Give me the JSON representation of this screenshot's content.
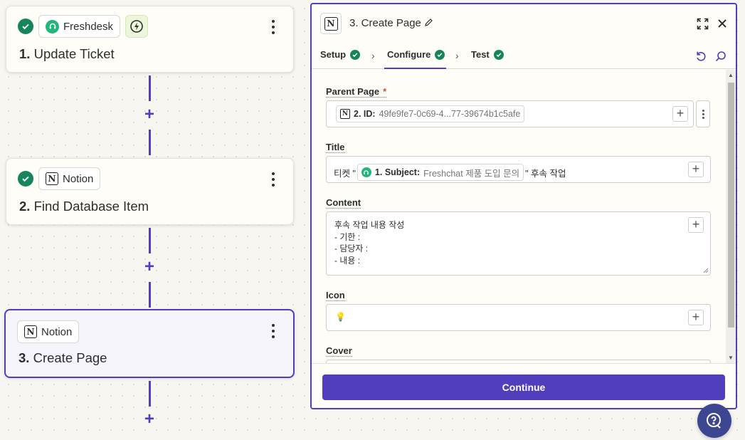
{
  "canvas": {
    "steps": [
      {
        "number": "1.",
        "name": "Update Ticket",
        "app": "Freshdesk"
      },
      {
        "number": "2.",
        "name": "Find Database Item",
        "app": "Notion"
      },
      {
        "number": "3.",
        "name": "Create Page",
        "app": "Notion"
      }
    ],
    "add_symbol": "+"
  },
  "panel": {
    "title": "3. Create Page",
    "tabs": [
      {
        "label": "Setup"
      },
      {
        "label": "Configure"
      },
      {
        "label": "Test"
      }
    ],
    "active_tab": "Configure",
    "fields": {
      "parent_page": {
        "label": "Parent Page",
        "required_mark": "*",
        "token_step": "2. ID:",
        "token_value": "49fe9fe7-0c69-4...77-39674b1c5afe"
      },
      "title": {
        "label": "Title",
        "prefix": "티켓 \"",
        "token_step": "1. Subject:",
        "token_value": "Freshchat 제품 도입 문의",
        "suffix": "\" 후속 작업"
      },
      "content": {
        "label": "Content",
        "lines": [
          "후속 작업 내용 작성",
          "- 기한 :",
          "- 담당자 :",
          "- 내용 :"
        ]
      },
      "icon": {
        "label": "Icon",
        "value": "💡"
      },
      "cover": {
        "label": "Cover"
      }
    },
    "continue_label": "Continue"
  },
  "colors": {
    "accent": "#503ebd",
    "success": "#15855b",
    "freshdesk": "#24b57a",
    "canvas_bg": "#f7f6f1",
    "help_button": "#3d4791"
  },
  "icons": {
    "step_status": "check-circle-icon",
    "freshdesk": "headset-icon",
    "instant_trigger": "lightning-bolt-icon",
    "notion": "notion-logo-icon",
    "menu": "more-vertical-icon",
    "edit": "pencil-icon",
    "expand": "expand-icon",
    "close": "close-icon",
    "undo": "undo-icon",
    "search": "search-icon",
    "help": "help-chat-icon"
  }
}
